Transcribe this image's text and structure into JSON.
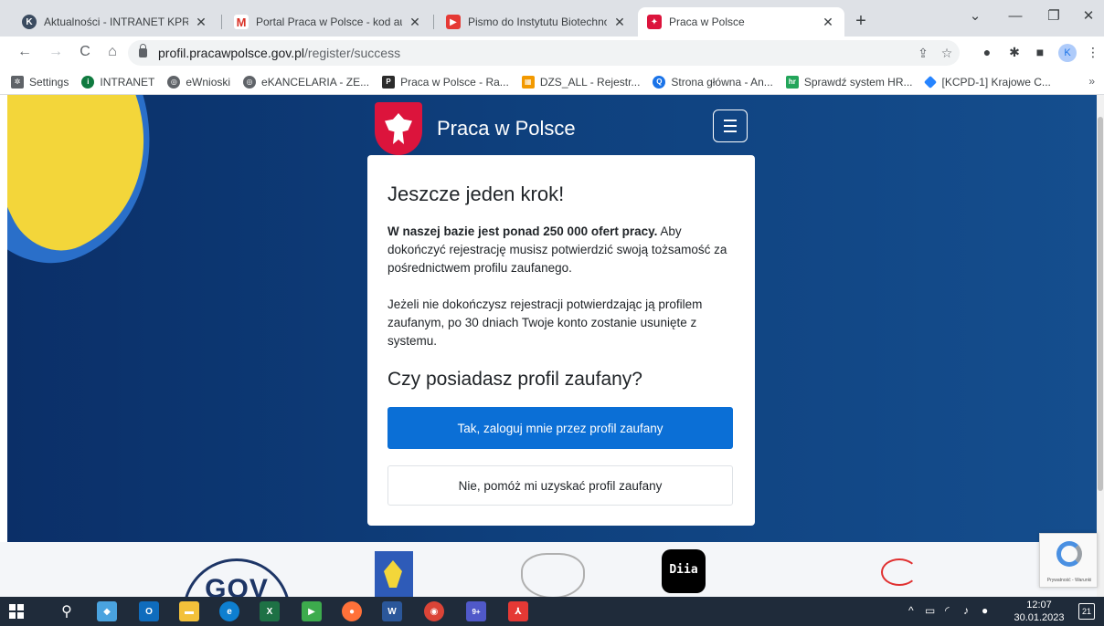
{
  "browser": {
    "tabs": [
      {
        "title": "Aktualności - INTRANET KPRM",
        "icon": "kprm-favicon",
        "color": "#3b4b60"
      },
      {
        "title": "Portal Praca w Polsce - kod autor",
        "icon": "gmail-favicon",
        "color": "#d93025"
      },
      {
        "title": "Pismo do Instytutu Biotechnologi",
        "icon": "pdf-favicon",
        "color": "#e53935"
      },
      {
        "title": "Praca w Polsce",
        "icon": "eagle-favicon",
        "color": "#dc143c",
        "active": true
      }
    ],
    "new_tab": "+",
    "window_controls": {
      "chevron": "⌄",
      "minimize": "—",
      "restore": "❐",
      "close": "✕"
    },
    "tab_close": "✕",
    "url_host": "profil.pracawpolsce.gov.pl",
    "url_path": "/register/success",
    "profile_initial": "K",
    "nav": {
      "back": "←",
      "forward": "→",
      "reload": "C",
      "home": "⌂"
    },
    "bookmarks": [
      {
        "label": "Settings",
        "icon": "gear-icon",
        "color": "#5f6368"
      },
      {
        "label": "INTRANET",
        "icon": "intranet-icon",
        "color": "#0f7a3f"
      },
      {
        "label": "eWnioski",
        "icon": "globe-icon",
        "color": "#5f6368"
      },
      {
        "label": "eKANCELARIA - ZE...",
        "icon": "globe-icon",
        "color": "#5f6368"
      },
      {
        "label": "Praca w Polsce - Ra...",
        "icon": "praca-icon",
        "color": "#2b2b2b"
      },
      {
        "label": "DZS_ALL - Rejestr...",
        "icon": "grid-icon",
        "color": "#f29900"
      },
      {
        "label": "Strona główna - An...",
        "icon": "search-icon",
        "color": "#1a73e8"
      },
      {
        "label": "Sprawdź system HR...",
        "icon": "hr-icon",
        "color": "#23a55a"
      },
      {
        "label": "[KCPD-1] Krajowe C...",
        "icon": "diamond-icon",
        "color": "#2684ff"
      }
    ],
    "bookmarks_more": "»"
  },
  "page": {
    "brand_title": "Praca w Polsce",
    "card": {
      "heading": "Jeszcze jeden krok!",
      "para1_bold": "W naszej bazie jest ponad 250 000 ofert pracy.",
      "para1_rest": " Aby dokończyć rejestrację musisz potwierdzić swoją tożsamość za pośrednictwem profilu zaufanego.",
      "para2": "Jeżeli nie dokończysz rejestracji potwierdzając ją profilem zaufanym, po 30 dniach Twoje konto zostanie usunięte z systemu.",
      "question": "Czy posiadasz profil zaufany?",
      "primary_button": "Tak, zaloguj mnie przez profil zaufany",
      "secondary_button": "Nie, pomóż mi uzyskać profil zaufany"
    },
    "footer_logos": {
      "gov": "GOV",
      "diia": "Diia"
    },
    "recaptcha_text": "Prywatność - Warunki"
  },
  "taskbar": {
    "time": "12:07",
    "date": "30.01.2023",
    "notifications": "21",
    "badge_teams": "9+"
  },
  "colors": {
    "primary": "#0b6fd6",
    "hero": "#0e3f7c",
    "brand_red": "#dc143c"
  }
}
